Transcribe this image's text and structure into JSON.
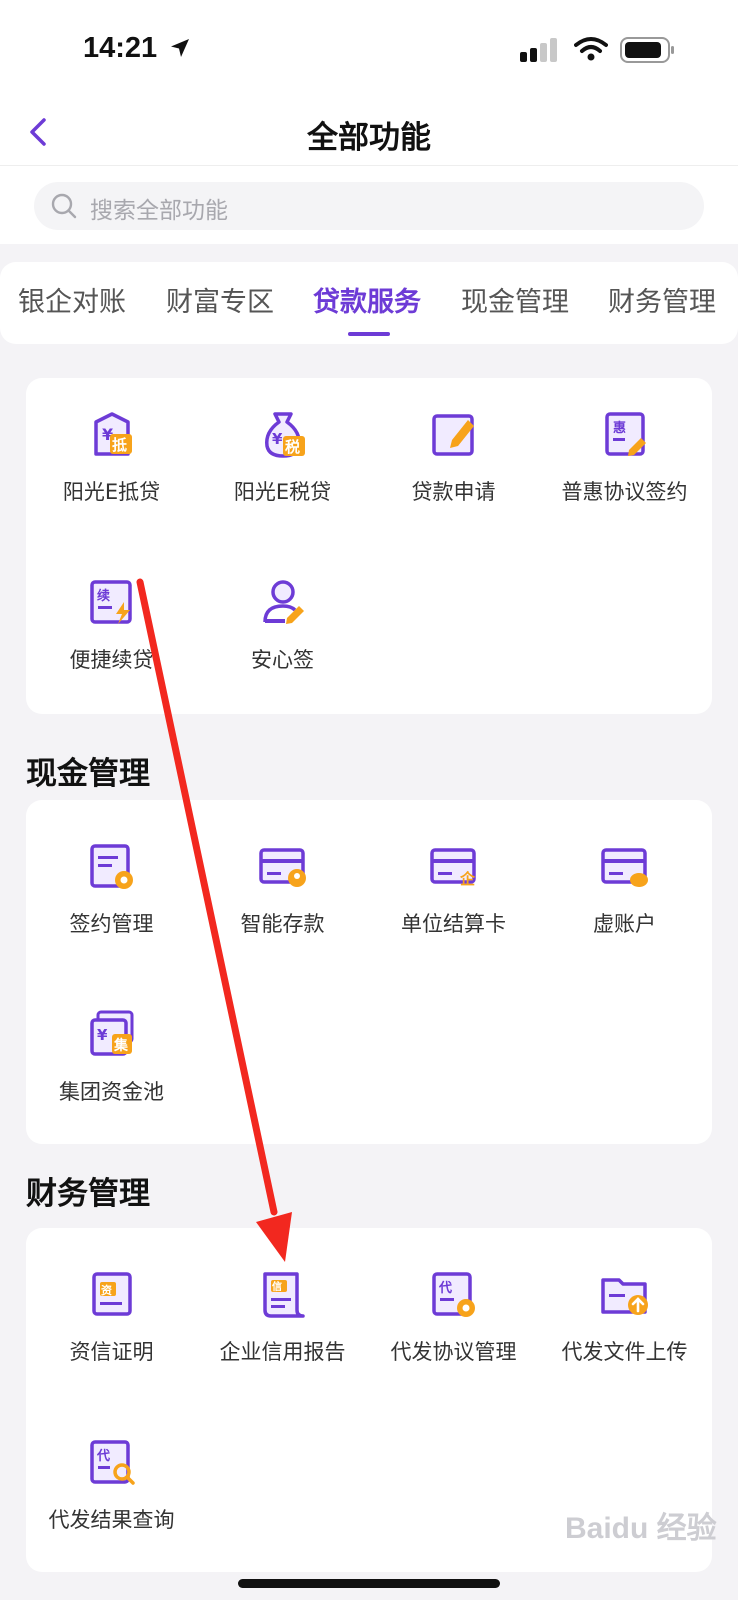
{
  "status": {
    "time": "14:21"
  },
  "nav": {
    "title": "全部功能"
  },
  "search": {
    "placeholder": "搜索全部功能"
  },
  "tabs": [
    "银企对账",
    "财富专区",
    "贷款服务",
    "现金管理",
    "财务管理"
  ],
  "active_tab": "贷款服务",
  "accent_color": "#6d3bd6",
  "loan": {
    "items": [
      {
        "label": "阳光E抵贷",
        "icon": "shield-mortgage-icon"
      },
      {
        "label": "阳光E税贷",
        "icon": "money-bag-tax-icon"
      },
      {
        "label": "贷款申请",
        "icon": "edit-form-icon"
      },
      {
        "label": "普惠协议签约",
        "icon": "agreement-sign-icon"
      },
      {
        "label": "便捷续贷",
        "icon": "renewal-loan-icon"
      },
      {
        "label": "安心签",
        "icon": "user-sign-icon"
      }
    ]
  },
  "cash": {
    "title": "现金管理",
    "items": [
      {
        "label": "签约管理",
        "icon": "contract-settings-icon"
      },
      {
        "label": "智能存款",
        "icon": "smart-deposit-card-icon"
      },
      {
        "label": "单位结算卡",
        "icon": "corporate-card-icon"
      },
      {
        "label": "虚账户",
        "icon": "virtual-account-card-icon"
      },
      {
        "label": "集团资金池",
        "icon": "group-fund-pool-icon"
      }
    ]
  },
  "finance": {
    "title": "财务管理",
    "items": [
      {
        "label": "资信证明",
        "icon": "credit-certificate-icon"
      },
      {
        "label": "企业信用报告",
        "icon": "credit-report-icon"
      },
      {
        "label": "代发协议管理",
        "icon": "payroll-agreement-icon"
      },
      {
        "label": "代发文件上传",
        "icon": "folder-upload-icon"
      },
      {
        "label": "代发结果查询",
        "icon": "payroll-query-icon"
      }
    ]
  },
  "watermark": {
    "text": "Baidu 经验"
  }
}
